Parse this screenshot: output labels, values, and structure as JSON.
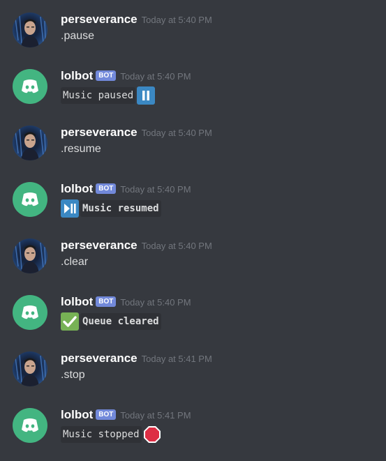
{
  "users": {
    "human": "perseverance",
    "bot": "lolbot",
    "bot_tag": "BOT"
  },
  "messages": [
    {
      "author": "perseverance",
      "time": "Today at 5:40 PM",
      "text": ".pause"
    },
    {
      "author": "lolbot",
      "time": "Today at 5:40 PM",
      "text": "Music paused",
      "emoji": "pause-button-icon"
    },
    {
      "author": "perseverance",
      "time": "Today at 5:40 PM",
      "text": ".resume"
    },
    {
      "author": "lolbot",
      "time": "Today at 5:40 PM",
      "text": "Music resumed",
      "emoji": "play-pause-button-icon"
    },
    {
      "author": "perseverance",
      "time": "Today at 5:40 PM",
      "text": ".clear"
    },
    {
      "author": "lolbot",
      "time": "Today at 5:40 PM",
      "text": "Queue cleared",
      "emoji": "check-mark-icon"
    },
    {
      "author": "perseverance",
      "time": "Today at 5:41 PM",
      "text": ".stop"
    },
    {
      "author": "lolbot",
      "time": "Today at 5:41 PM",
      "text": "Music stopped",
      "emoji": "stop-sign-icon"
    }
  ],
  "colors": {
    "background": "#36393f",
    "bot_tag": "#7289da",
    "bot_avatar": "#43b581",
    "timestamp": "#72767d",
    "code_bg": "#2f3136"
  }
}
